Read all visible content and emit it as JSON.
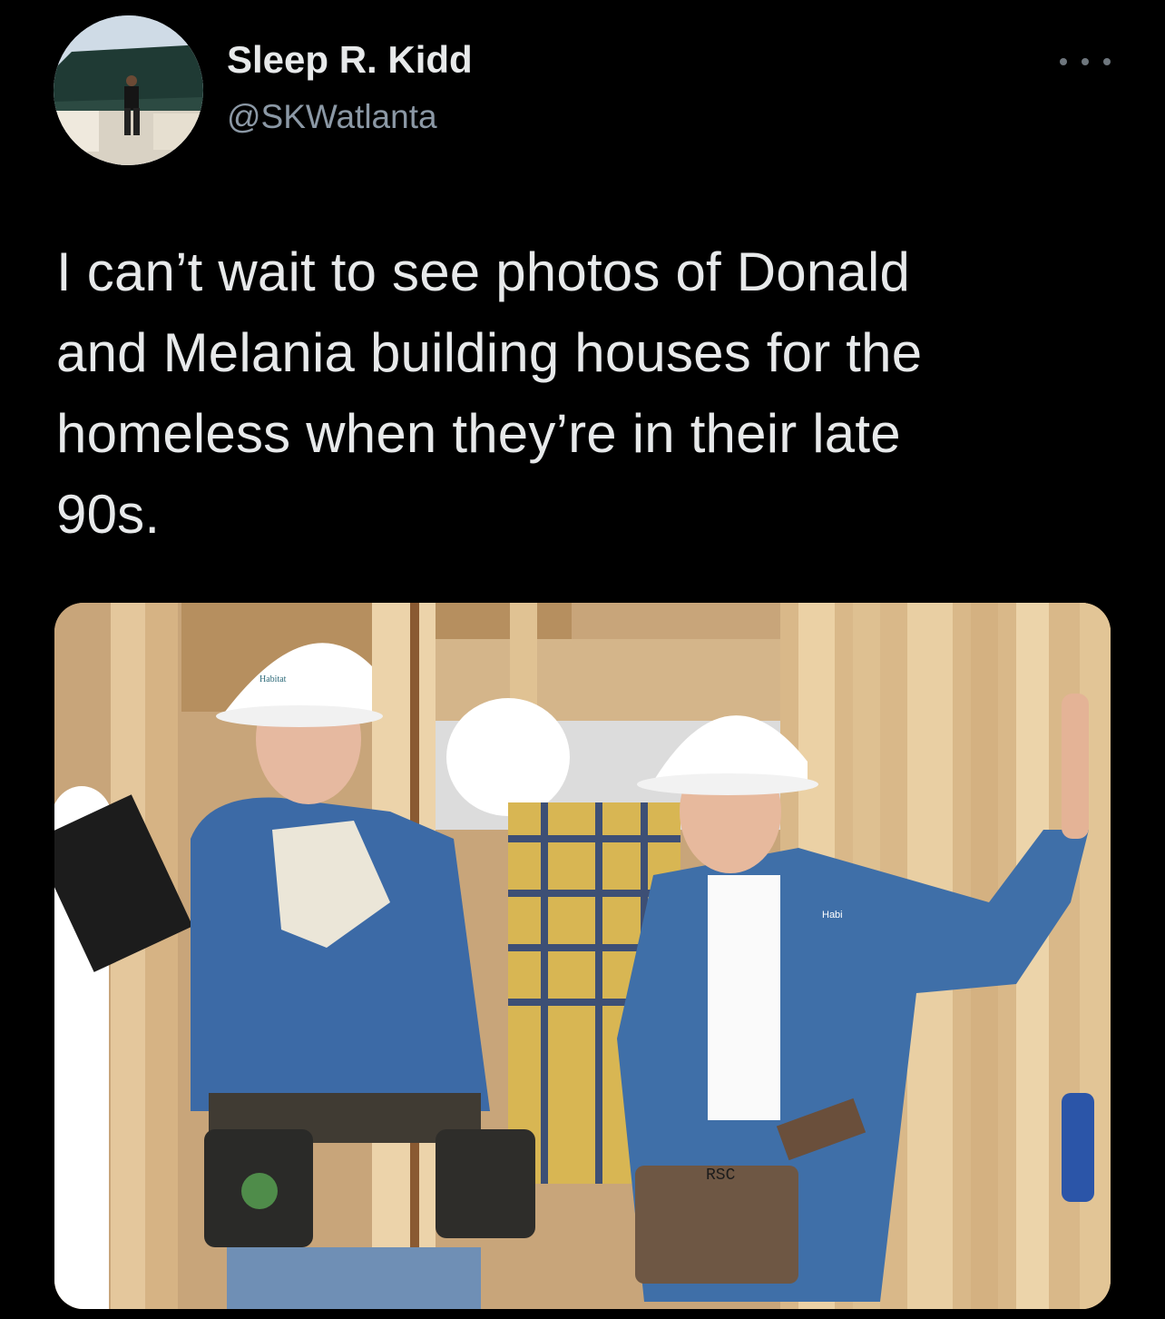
{
  "author": {
    "display_name": "Sleep R. Kidd",
    "handle": "@SKWatlanta"
  },
  "tweet": {
    "text_lines": [
      "I can’t wait to see photos of Donald",
      "and Melania building houses for the",
      "homeless when they’re in their late",
      "90s."
    ]
  },
  "media": {
    "hardhat_label": "Habitat",
    "apron_stamp": "RSC",
    "shirt_logo": "Habi"
  },
  "icons": {
    "more": "more-horizontal-icon"
  },
  "colors": {
    "background": "#000000",
    "primary_text": "#e7e9ea",
    "secondary_text": "#8b98a5"
  }
}
